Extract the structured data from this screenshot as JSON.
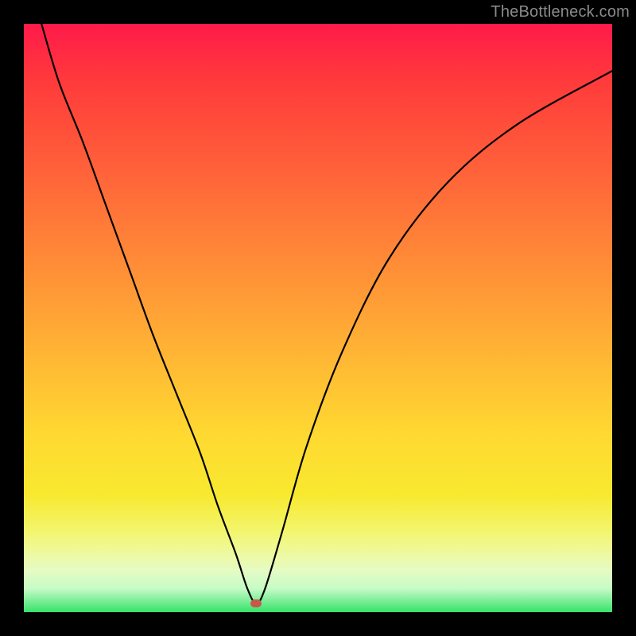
{
  "watermark": {
    "text": "TheBottleneck.com"
  },
  "marker": {
    "x_ratio": 0.395,
    "y_ratio": 0.985
  },
  "chart_data": {
    "type": "line",
    "title": "",
    "xlabel": "",
    "ylabel": "",
    "xlim": [
      0,
      100
    ],
    "ylim": [
      0,
      100
    ],
    "grid": false,
    "legend": false,
    "series": [
      {
        "name": "curve",
        "x": [
          3,
          6,
          10,
          14,
          18,
          22,
          26,
          30,
          33,
          36,
          38,
          39.5,
          41,
          44,
          48,
          54,
          62,
          72,
          84,
          100
        ],
        "y": [
          100,
          90,
          80,
          69,
          58,
          47,
          37,
          27,
          18,
          10,
          4,
          1.5,
          4,
          14,
          28,
          44,
          60,
          73,
          83,
          92
        ]
      }
    ],
    "marker_point": {
      "x": 39.5,
      "y": 1.5
    },
    "background_gradient": {
      "stops": [
        {
          "pos": 0.0,
          "color": "#ff1a4a"
        },
        {
          "pos": 0.1,
          "color": "#ff3b3b"
        },
        {
          "pos": 0.22,
          "color": "#ff5a3a"
        },
        {
          "pos": 0.34,
          "color": "#ff7a38"
        },
        {
          "pos": 0.46,
          "color": "#ff9a36"
        },
        {
          "pos": 0.58,
          "color": "#ffba34"
        },
        {
          "pos": 0.7,
          "color": "#ffd931"
        },
        {
          "pos": 0.8,
          "color": "#f8e92f"
        },
        {
          "pos": 0.86,
          "color": "#f3f56a"
        },
        {
          "pos": 0.9,
          "color": "#eef9a0"
        },
        {
          "pos": 0.93,
          "color": "#e5fbc4"
        },
        {
          "pos": 0.96,
          "color": "#c6fbc6"
        },
        {
          "pos": 1.0,
          "color": "#36e26a"
        }
      ]
    }
  }
}
